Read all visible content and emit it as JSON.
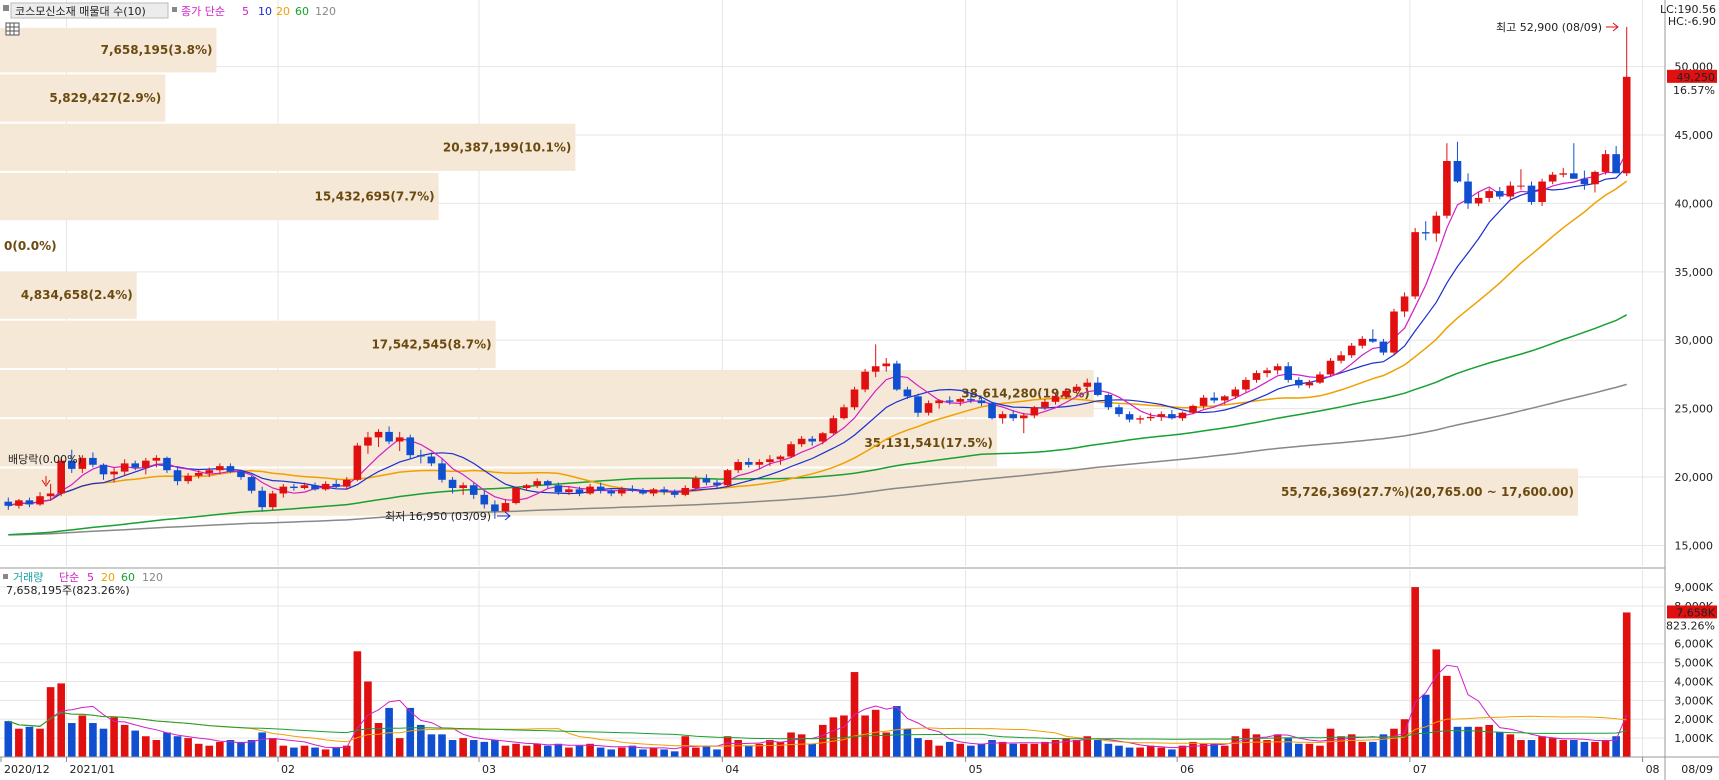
{
  "price_panel": {
    "title": "코스모신소재 매물대 수(10)",
    "legend": {
      "prefix": "종가 단순",
      "items": [
        {
          "label": "5",
          "color": "#d020c8"
        },
        {
          "label": "10",
          "color": "#1a2fd0"
        },
        {
          "label": "20",
          "color": "#f0a000"
        },
        {
          "label": "60",
          "color": "#18a030"
        },
        {
          "label": "120",
          "color": "#888888"
        }
      ]
    },
    "lc_label": "LC:190.56",
    "hc_label": "HC:-6.90",
    "current_price": "49,250",
    "current_change": "16.57%",
    "high_label": "최고 52,900 (08/09)",
    "low_label": "최저 16,950 (03/09)",
    "dividend_label": "배당락(0.00%)",
    "grid_icon": "table-grid-icon"
  },
  "volume_panel": {
    "legend_prefix": "거래량",
    "legend_sma": "단순",
    "legend_items": [
      {
        "label": "5",
        "color": "#d020c8"
      },
      {
        "label": "20",
        "color": "#f0a000"
      },
      {
        "label": "60",
        "color": "#18a030"
      },
      {
        "label": "120",
        "color": "#888888"
      }
    ],
    "info": "7,658,195주(823.26%)",
    "current_volume": "7,658K",
    "current_volume_pct": "823.26%"
  },
  "x_axis_labels": [
    "2020/12",
    "2021/01",
    "02",
    "03",
    "04",
    "05",
    "06",
    "07",
    "08"
  ],
  "x_axis_right_label": "08/09",
  "colors": {
    "up": "#e01010",
    "down": "#1050d0",
    "zone": "#f6e8d6",
    "zone_text": "#6b4a10"
  },
  "chart_data": {
    "type": "candlestick-with-volume-profile",
    "title": "코스모신소재 매물대 수(10)",
    "price_axis": {
      "ticks": [
        15000,
        20000,
        25000,
        30000,
        35000,
        40000,
        45000,
        50000
      ],
      "tick_labels": [
        "15,000",
        "20,000",
        "25,000",
        "30,000",
        "35,000",
        "40,000",
        "45,000",
        "50,000"
      ],
      "range": [
        13500,
        54500
      ]
    },
    "volume_axis": {
      "ticks": [
        1000,
        2000,
        3000,
        4000,
        5000,
        6000,
        8000,
        9000
      ],
      "tick_labels": [
        "1,000K",
        "2,000K",
        "3,000K",
        "4,000K",
        "5,000K",
        "6,000K",
        "8,000K",
        "9,000K"
      ],
      "range": [
        0,
        9800
      ]
    },
    "months": [
      "2020/12",
      "2021/01",
      "02",
      "03",
      "04",
      "05",
      "06",
      "07",
      "08"
    ],
    "volume_profile": [
      {
        "label": "7,658,195(3.8%)",
        "low": 49500,
        "high": 52900,
        "pct": 3.8
      },
      {
        "label": "5,829,427(2.9%)",
        "low": 45900,
        "high": 49500,
        "pct": 2.9
      },
      {
        "label": "20,387,199(10.1%)",
        "low": 42300,
        "high": 45900,
        "pct": 10.1
      },
      {
        "label": "15,432,695(7.7%)",
        "low": 38700,
        "high": 42300,
        "pct": 7.7
      },
      {
        "label": "0(0.0%)",
        "low": 35100,
        "high": 38700,
        "pct": 0.0
      },
      {
        "label": "4,834,658(2.4%)",
        "low": 31500,
        "high": 35100,
        "pct": 2.4
      },
      {
        "label": "17,542,545(8.7%)",
        "low": 27900,
        "high": 31500,
        "pct": 8.7
      },
      {
        "label": "38,614,280(19.2%)",
        "low": 24300,
        "high": 27900,
        "pct": 19.2
      },
      {
        "label": "35,131,541(17.5%)",
        "low": 20700,
        "high": 24300,
        "pct": 17.5
      },
      {
        "label": "55,726,369(27.7%)(20,765.00 ~ 17,600.00)",
        "low": 17100,
        "high": 20700,
        "pct": 27.7
      }
    ],
    "candles": [
      [
        18200,
        18500,
        17600,
        17900,
        1900
      ],
      [
        17900,
        18400,
        17700,
        18300,
        1500
      ],
      [
        18300,
        18500,
        17800,
        18000,
        1600
      ],
      [
        18000,
        18900,
        17900,
        18600,
        1500
      ],
      [
        18600,
        19500,
        18300,
        18800,
        3700
      ],
      [
        18800,
        21400,
        18600,
        21200,
        3900
      ],
      [
        21200,
        22000,
        20300,
        20600,
        1800
      ],
      [
        20600,
        21600,
        20300,
        21400,
        2200
      ],
      [
        21400,
        21800,
        20700,
        20900,
        1800
      ],
      [
        20900,
        21000,
        19800,
        20200,
        1500
      ],
      [
        20200,
        20700,
        19600,
        20400,
        2100
      ],
      [
        20400,
        21300,
        20100,
        21000,
        1700
      ],
      [
        21000,
        21200,
        20500,
        20700,
        1400
      ],
      [
        20700,
        21400,
        20200,
        21200,
        1100
      ],
      [
        21200,
        21600,
        20700,
        21400,
        900
      ],
      [
        21400,
        21500,
        20300,
        20500,
        1300
      ],
      [
        20500,
        20700,
        19400,
        19700,
        1100
      ],
      [
        19700,
        20300,
        19500,
        20100,
        1000
      ],
      [
        20100,
        20500,
        19900,
        20300,
        700
      ],
      [
        20300,
        20700,
        20000,
        20500,
        600
      ],
      [
        20500,
        21000,
        20200,
        20800,
        800
      ],
      [
        20800,
        21000,
        20300,
        20400,
        900
      ],
      [
        20400,
        20500,
        19800,
        20000,
        800
      ],
      [
        20000,
        20100,
        18800,
        19000,
        900
      ],
      [
        19000,
        19300,
        17500,
        17800,
        1300
      ],
      [
        17800,
        19000,
        17600,
        18800,
        1000
      ],
      [
        18800,
        19500,
        18500,
        19300,
        600
      ],
      [
        19300,
        19500,
        19000,
        19200,
        500
      ],
      [
        19200,
        19600,
        19100,
        19400,
        600
      ],
      [
        19400,
        19600,
        19000,
        19100,
        500
      ],
      [
        19100,
        19700,
        19000,
        19500,
        400
      ],
      [
        19500,
        19800,
        19200,
        19300,
        500
      ],
      [
        19300,
        20000,
        19100,
        19800,
        600
      ],
      [
        19800,
        22500,
        19700,
        22300,
        5600
      ],
      [
        22300,
        23300,
        21700,
        22900,
        4000
      ],
      [
        22900,
        23500,
        22200,
        23300,
        1800
      ],
      [
        23300,
        23700,
        22400,
        22600,
        2600
      ],
      [
        22600,
        23300,
        21900,
        22900,
        1000
      ],
      [
        22900,
        23100,
        21300,
        21600,
        2600
      ],
      [
        21600,
        22000,
        21000,
        21500,
        1700
      ],
      [
        21500,
        21800,
        20800,
        21000,
        1200
      ],
      [
        21000,
        21300,
        19600,
        19800,
        1200
      ],
      [
        19800,
        20000,
        18800,
        19200,
        900
      ],
      [
        19200,
        19600,
        18700,
        19400,
        1000
      ],
      [
        19400,
        19600,
        18400,
        18700,
        900
      ],
      [
        18700,
        19000,
        17700,
        18000,
        800
      ],
      [
        18000,
        18300,
        16950,
        17500,
        900
      ],
      [
        17500,
        18400,
        17400,
        18100,
        600
      ],
      [
        18100,
        19300,
        18000,
        19200,
        700
      ],
      [
        19200,
        19500,
        19000,
        19400,
        600
      ],
      [
        19400,
        19900,
        19200,
        19700,
        700
      ],
      [
        19700,
        19800,
        19200,
        19400,
        600
      ],
      [
        19400,
        19600,
        18700,
        18900,
        700
      ],
      [
        18900,
        19300,
        18700,
        19100,
        500
      ],
      [
        19100,
        19300,
        18600,
        18800,
        600
      ],
      [
        18800,
        19500,
        18700,
        19300,
        700
      ],
      [
        19300,
        19600,
        18800,
        19000,
        500
      ],
      [
        19000,
        19200,
        18600,
        18800,
        400
      ],
      [
        18800,
        19300,
        18600,
        19100,
        500
      ],
      [
        19100,
        19400,
        18900,
        19000,
        600
      ],
      [
        19000,
        19200,
        18700,
        18800,
        400
      ],
      [
        18800,
        19200,
        18600,
        19100,
        500
      ],
      [
        19100,
        19300,
        18700,
        18900,
        400
      ],
      [
        18900,
        19100,
        18500,
        18700,
        300
      ],
      [
        18700,
        19400,
        18600,
        19200,
        1100
      ],
      [
        19200,
        20100,
        19100,
        19900,
        500
      ],
      [
        19900,
        20200,
        19400,
        19600,
        600
      ],
      [
        19600,
        19800,
        19200,
        19400,
        400
      ],
      [
        19400,
        20600,
        19300,
        20500,
        1100
      ],
      [
        20500,
        21300,
        20300,
        21100,
        900
      ],
      [
        21100,
        21400,
        20700,
        20900,
        600
      ],
      [
        20900,
        21300,
        20600,
        21100,
        700
      ],
      [
        21100,
        21600,
        20800,
        21300,
        900
      ],
      [
        21300,
        21600,
        20900,
        21500,
        800
      ],
      [
        21500,
        22600,
        21400,
        22400,
        1300
      ],
      [
        22400,
        23000,
        22200,
        22800,
        1200
      ],
      [
        22800,
        23000,
        22300,
        22600,
        700
      ],
      [
        22600,
        23300,
        22400,
        23200,
        1700
      ],
      [
        23200,
        24500,
        23100,
        24300,
        2100
      ],
      [
        24300,
        25300,
        24200,
        25100,
        2200
      ],
      [
        25100,
        26600,
        24900,
        26400,
        4500
      ],
      [
        26400,
        27900,
        26200,
        27700,
        2200
      ],
      [
        27700,
        29700,
        27300,
        28100,
        2500
      ],
      [
        28100,
        28700,
        27700,
        28300,
        1300
      ],
      [
        28300,
        28500,
        26300,
        26400,
        2700
      ],
      [
        26400,
        26600,
        25700,
        25900,
        1500
      ],
      [
        25900,
        26100,
        24400,
        24700,
        1000
      ],
      [
        24700,
        25600,
        24500,
        25400,
        900
      ],
      [
        25400,
        25700,
        25000,
        25600,
        600
      ],
      [
        25600,
        25900,
        25300,
        25500,
        800
      ],
      [
        25500,
        25800,
        25200,
        25700,
        700
      ],
      [
        25700,
        26000,
        25400,
        25600,
        600
      ],
      [
        25600,
        25800,
        25200,
        25400,
        700
      ],
      [
        25400,
        25500,
        24200,
        24300,
        900
      ],
      [
        24300,
        24800,
        23900,
        24600,
        800
      ],
      [
        24600,
        24900,
        24100,
        24300,
        700
      ],
      [
        24300,
        24700,
        23200,
        24500,
        700
      ],
      [
        24500,
        25200,
        24300,
        25100,
        700
      ],
      [
        25100,
        25700,
        24900,
        25500,
        800
      ],
      [
        25500,
        26100,
        25300,
        25900,
        900
      ],
      [
        25900,
        26500,
        25700,
        26300,
        1000
      ],
      [
        26300,
        26800,
        26100,
        26600,
        900
      ],
      [
        26600,
        27200,
        26400,
        26900,
        1100
      ],
      [
        26900,
        27300,
        25900,
        26000,
        900
      ],
      [
        26000,
        26100,
        24900,
        25100,
        700
      ],
      [
        25100,
        25300,
        24400,
        24600,
        600
      ],
      [
        24600,
        24800,
        24000,
        24200,
        500
      ],
      [
        24200,
        24500,
        23900,
        24300,
        500
      ],
      [
        24300,
        24700,
        24100,
        24400,
        600
      ],
      [
        24400,
        24800,
        24100,
        24600,
        500
      ],
      [
        24600,
        24900,
        24200,
        24300,
        400
      ],
      [
        24300,
        24800,
        24100,
        24700,
        600
      ],
      [
        24700,
        25300,
        24600,
        25200,
        800
      ],
      [
        25200,
        26000,
        25000,
        25800,
        700
      ],
      [
        25800,
        26200,
        25400,
        25600,
        700
      ],
      [
        25600,
        26000,
        25300,
        25900,
        600
      ],
      [
        25900,
        26600,
        25700,
        26400,
        1100
      ],
      [
        26400,
        27300,
        26200,
        27100,
        1500
      ],
      [
        27100,
        27800,
        26900,
        27600,
        1200
      ],
      [
        27600,
        28000,
        27300,
        27800,
        900
      ],
      [
        27800,
        28300,
        27500,
        28100,
        1200
      ],
      [
        28100,
        28400,
        26900,
        27100,
        1000
      ],
      [
        27100,
        27300,
        26500,
        26700,
        700
      ],
      [
        26700,
        27100,
        26500,
        26900,
        700
      ],
      [
        26900,
        27700,
        26800,
        27500,
        600
      ],
      [
        27500,
        28700,
        27400,
        28500,
        1500
      ],
      [
        28500,
        29200,
        28300,
        28900,
        1100
      ],
      [
        28900,
        29800,
        28700,
        29600,
        1200
      ],
      [
        29600,
        30300,
        29400,
        30100,
        800
      ],
      [
        30100,
        30800,
        29800,
        29900,
        800
      ],
      [
        29900,
        30100,
        28900,
        29100,
        1200
      ],
      [
        29100,
        32300,
        28900,
        32100,
        1500
      ],
      [
        32100,
        33500,
        31700,
        33200,
        2000
      ],
      [
        33200,
        38200,
        33000,
        37900,
        9000
      ],
      [
        37900,
        38700,
        37300,
        37800,
        3300
      ],
      [
        37800,
        39400,
        37200,
        39100,
        5700
      ],
      [
        39100,
        44400,
        38900,
        43100,
        4300
      ],
      [
        43100,
        44500,
        41500,
        41600,
        1600
      ],
      [
        41600,
        42200,
        39600,
        40000,
        1600
      ],
      [
        40000,
        40800,
        39800,
        40400,
        1600
      ],
      [
        40400,
        41100,
        40100,
        40900,
        1700
      ],
      [
        40900,
        41200,
        40300,
        40500,
        1300
      ],
      [
        40500,
        41600,
        40300,
        41300,
        1200
      ],
      [
        41300,
        42500,
        41000,
        41300,
        900
      ],
      [
        41300,
        41600,
        39900,
        40100,
        900
      ],
      [
        40100,
        41800,
        39800,
        41600,
        1100
      ],
      [
        41600,
        42300,
        41400,
        42100,
        1000
      ],
      [
        42100,
        42600,
        41900,
        42200,
        900
      ],
      [
        42200,
        44400,
        41800,
        41800,
        900
      ],
      [
        41800,
        42400,
        41000,
        41400,
        800
      ],
      [
        41400,
        42400,
        40800,
        42300,
        800
      ],
      [
        42300,
        43900,
        42100,
        43600,
        900
      ],
      [
        43600,
        44200,
        42400,
        42200,
        1100
      ],
      [
        42200,
        52900,
        42000,
        49250,
        7658
      ]
    ]
  }
}
